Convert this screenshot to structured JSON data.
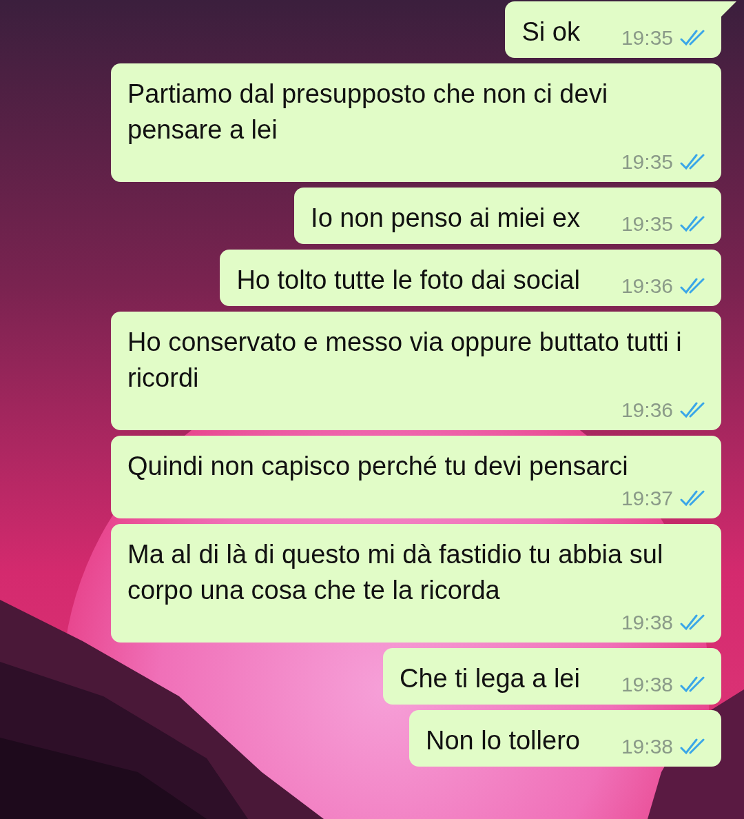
{
  "messages": [
    {
      "text": "Si ok",
      "time": "19:35",
      "read": true,
      "tail": true
    },
    {
      "text": "Partiamo dal presupposto che non ci devi pensare a lei",
      "time": "19:35",
      "read": true,
      "tail": false
    },
    {
      "text": "Io non penso ai miei ex",
      "time": "19:35",
      "read": true,
      "tail": false
    },
    {
      "text": "Ho tolto tutte le foto dai social",
      "time": "19:36",
      "read": true,
      "tail": false
    },
    {
      "text": "Ho conservato e messo via oppure buttato tutti i ricordi",
      "time": "19:36",
      "read": true,
      "tail": false
    },
    {
      "text": "Quindi non capisco perché tu devi pensarci",
      "time": "19:37",
      "read": true,
      "tail": false
    },
    {
      "text": "Ma al di là di questo mi dà fastidio tu abbia sul corpo una cosa che te la ricorda",
      "time": "19:38",
      "read": true,
      "tail": false
    },
    {
      "text": "Che ti lega a lei",
      "time": "19:38",
      "read": true,
      "tail": false
    },
    {
      "text": "Non lo tollero",
      "time": "19:38",
      "read": true,
      "tail": false
    }
  ]
}
